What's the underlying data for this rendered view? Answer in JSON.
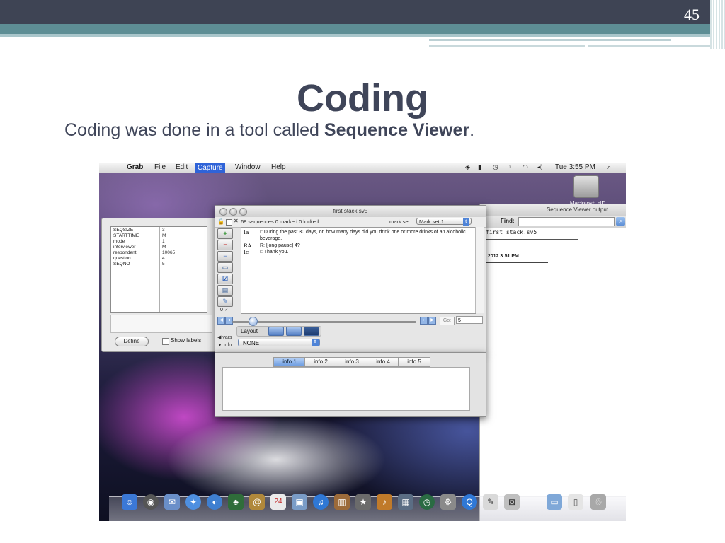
{
  "slide": {
    "number": "45",
    "title": "Coding",
    "subtitle_prefix": "Coding was done in a tool called ",
    "subtitle_bold": "Sequence Viewer",
    "subtitle_suffix": "."
  },
  "menubar": {
    "apple": "",
    "app": "Grab",
    "items": [
      "File",
      "Edit",
      "Capture",
      "Window",
      "Help"
    ],
    "active_item": "Capture",
    "clock": "Tue 3:55 PM",
    "tray": [
      "◈",
      "▮",
      "◷",
      "ᚼ",
      "◠",
      "◂)",
      "⌕"
    ]
  },
  "desktop": {
    "hd_label": "Macintosh HD"
  },
  "output_window": {
    "title": "Sequence Viewer output",
    "find_label": "Find:",
    "find_value": "",
    "filename": "first stack.sv5",
    "date_text": ", 2012 3:51 PM"
  },
  "info_panel": {
    "rows": [
      {
        "key": "SEQSIZE",
        "value": "3"
      },
      {
        "key": "STARTTIME",
        "value": "M"
      },
      {
        "key": "mode",
        "value": "1"
      },
      {
        "key": "interviewer",
        "value": "M"
      },
      {
        "key": "respondent",
        "value": "10065"
      },
      {
        "key": "question",
        "value": "4"
      },
      {
        "key": "SEQNO",
        "value": "5"
      }
    ],
    "define_label": "Define",
    "show_labels": "Show labels"
  },
  "main_window": {
    "title": "first stack.sv5",
    "stats": "68 sequences   0 marked   0 locked",
    "markset_label": "mark set:",
    "markset_value": "Mark set 1",
    "sequence": [
      {
        "code": "Ia",
        "text": "I: During the past 30 days, on how many days did you drink one or more drinks of an alcoholic beverage."
      },
      {
        "code": "RA",
        "text": "R: [long pause] 4?"
      },
      {
        "code": "Ic",
        "text": "I: Thank you."
      }
    ],
    "zero_check": "0 ✓",
    "go_label": "Go:",
    "go_value": "5",
    "layout_label": "Layout",
    "vars_label": "◀ vars",
    "info_label": "▼ info",
    "none_value": "NONE"
  },
  "lower_window": {
    "tabs": [
      "info 1",
      "info 2",
      "info 3",
      "info 4",
      "info 5"
    ],
    "active_tab": "info 1"
  },
  "colors": {
    "header_band": "#3e4454",
    "teal_band": "#5e8e95",
    "title_text": "#3f4559",
    "menu_highlight": "#2f63d8"
  }
}
